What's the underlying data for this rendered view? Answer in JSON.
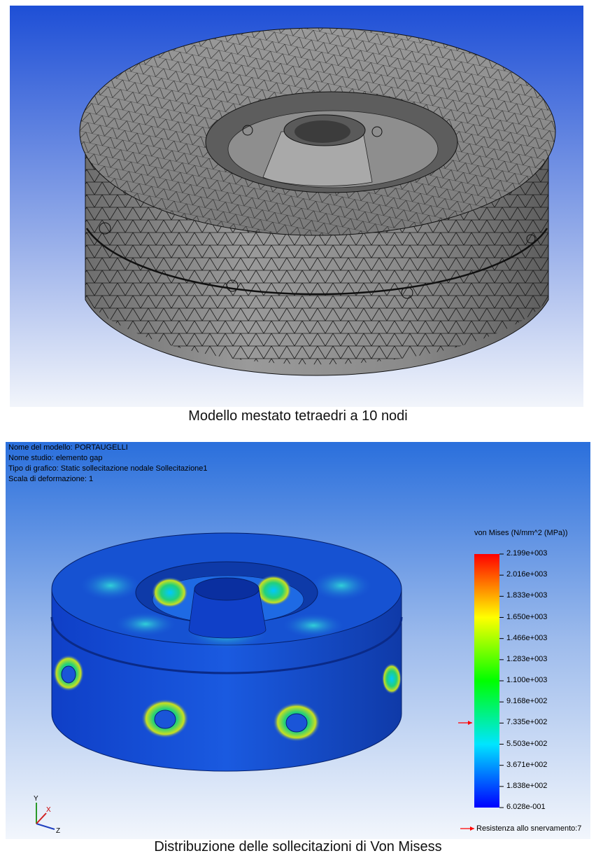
{
  "top_panel": {
    "caption": "Modello mestato tetraedri a 10 nodi",
    "colors": {
      "background_top": "#1e4fd6",
      "background_bottom": "#f2f5fb",
      "mesh_face": "#8c8c8c",
      "mesh_line": "#1a1a1a"
    }
  },
  "bottom_panel": {
    "caption": "Distribuzione delle sollecitazioni di Von Misess",
    "info": {
      "model_name": "Nome del modello: PORTAUGELLI",
      "study_name": "Nome studio: elemento gap",
      "plot_type": "Tipo di grafico: Static sollecitazione nodale Sollecitazione1",
      "deformation_scale": "Scala di deformazione: 1"
    },
    "legend": {
      "title": "von Mises (N/mm^2 (MPa))",
      "ticks": [
        "2.199e+003",
        "2.016e+003",
        "1.833e+003",
        "1.650e+003",
        "1.466e+003",
        "1.283e+003",
        "1.100e+003",
        "9.168e+002",
        "7.335e+002",
        "5.503e+002",
        "3.671e+002",
        "1.838e+002",
        "6.028e-001"
      ],
      "yield_strength_label": "Resistenza allo snervamento:7",
      "yield_strength_value": 733.5,
      "colors": {
        "high": "#ff0000",
        "mid_high": "#ffff00",
        "mid": "#00ff00",
        "mid_low": "#00e5ff",
        "low": "#0000ff",
        "arrow": "#ff0000"
      }
    },
    "triad": {
      "x": "X",
      "y": "Y",
      "z": "Z"
    },
    "colors": {
      "background_top": "#2a6fdc",
      "background_bottom": "#f2f6fc",
      "body": "#1a55d8"
    }
  }
}
